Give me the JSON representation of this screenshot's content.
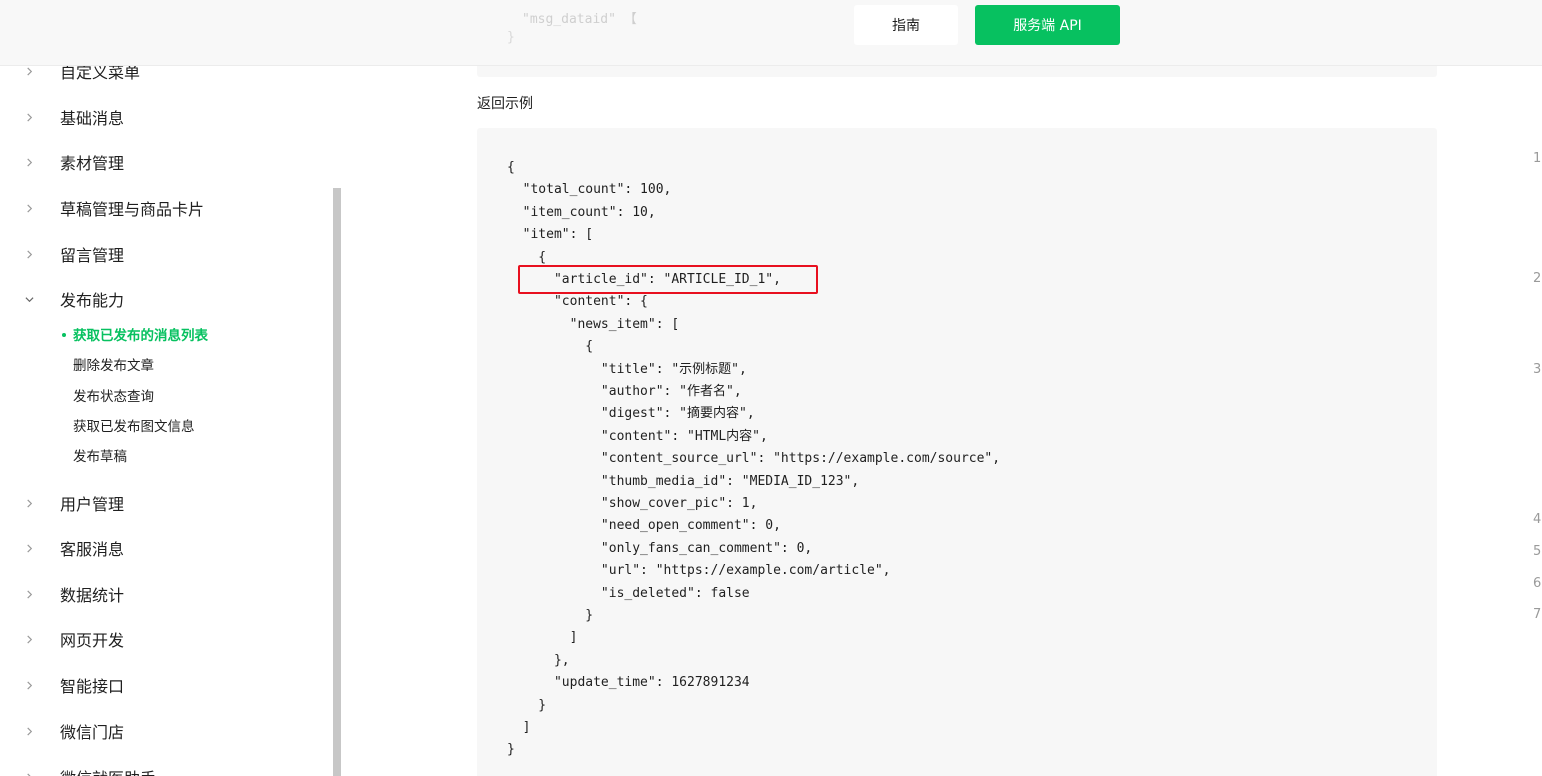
{
  "header": {
    "faded_text_1": "\"msg_dataid\" 【",
    "faded_text_2": "}",
    "guide_label": "指南",
    "api_label": "服务端 API"
  },
  "sidebar": {
    "items": [
      {
        "label": "自定义菜单",
        "expanded": false
      },
      {
        "label": "基础消息",
        "expanded": false
      },
      {
        "label": "素材管理",
        "expanded": false
      },
      {
        "label": "草稿管理与商品卡片",
        "expanded": false
      },
      {
        "label": "留言管理",
        "expanded": false
      },
      {
        "label": "发布能力",
        "expanded": true
      },
      {
        "label": "用户管理",
        "expanded": false
      },
      {
        "label": "客服消息",
        "expanded": false
      },
      {
        "label": "数据统计",
        "expanded": false
      },
      {
        "label": "网页开发",
        "expanded": false
      },
      {
        "label": "智能接口",
        "expanded": false
      },
      {
        "label": "微信门店",
        "expanded": false
      },
      {
        "label": "微信就医助手",
        "expanded": false
      }
    ],
    "sub_items": [
      {
        "label": "获取已发布的消息列表",
        "active": true
      },
      {
        "label": "删除发布文章",
        "active": false
      },
      {
        "label": "发布状态查询",
        "active": false
      },
      {
        "label": "获取已发布图文信息",
        "active": false
      },
      {
        "label": "发布草稿",
        "active": false
      }
    ]
  },
  "main": {
    "section_title": "返回示例",
    "code_lines": [
      "{",
      "  \"total_count\": 100,",
      "  \"item_count\": 10,",
      "  \"item\": [",
      "    {",
      "      \"article_id\": \"ARTICLE_ID_1\",",
      "      \"content\": {",
      "        \"news_item\": [",
      "          {",
      "            \"title\": \"示例标题\",",
      "            \"author\": \"作者名\",",
      "            \"digest\": \"摘要内容\",",
      "            \"content\": \"HTML内容\",",
      "            \"content_source_url\": \"https://example.com/source\",",
      "            \"thumb_media_id\": \"MEDIA_ID_123\",",
      "            \"show_cover_pic\": 1,",
      "            \"need_open_comment\": 0,",
      "            \"only_fans_can_comment\": 0,",
      "            \"url\": \"https://example.com/article\",",
      "            \"is_deleted\": false",
      "          }",
      "        ]",
      "      },",
      "      \"update_time\": 1627891234",
      "    }",
      "  ]",
      "}"
    ],
    "highlighted_line": "\"article_id\": \"ARTICLE_ID_1\","
  },
  "gutter": {
    "numbers": [
      "1",
      "2",
      "3",
      "4",
      "5",
      "6",
      "7"
    ]
  },
  "colors": {
    "accent": "#07c160",
    "highlight": "#e8101f",
    "code_bg": "#f7f7f7"
  }
}
